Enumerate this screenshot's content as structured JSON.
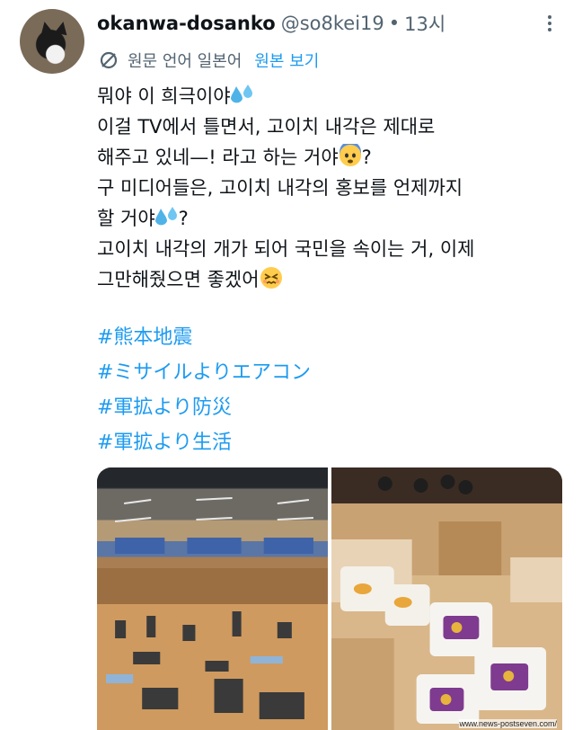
{
  "tweet": {
    "display_name": "okanwa-dosanko",
    "handle": "@so8kei19",
    "separator": "•",
    "time": "13시",
    "translate": {
      "language_label": "원문 언어 일본어",
      "show_original": "원본 보기"
    },
    "lines": [
      "뭐야 이 희극이야",
      "이걸 TV에서 틀면서, 고이치 내각은 제대로",
      "해주고 있네—! 라고 하는 거야",
      "?",
      "구 미디어들은, 고이치 내각의 홍보를 언제까지",
      "할 거야",
      "?",
      "고이치 내각의 개가 되어 국민을 속이는 거, 이제",
      "그만해줬으면 좋겠어"
    ],
    "hashtags": [
      "#熊本地震",
      "#ミサイルよりエアコン",
      "#軍拡より防災",
      "#軍拡より生活"
    ],
    "media": {
      "caption": "www.news-postseven.com/"
    }
  },
  "colors": {
    "accent": "#1d9bf0",
    "secondary_text": "#536471",
    "primary_text": "#0f1419"
  }
}
